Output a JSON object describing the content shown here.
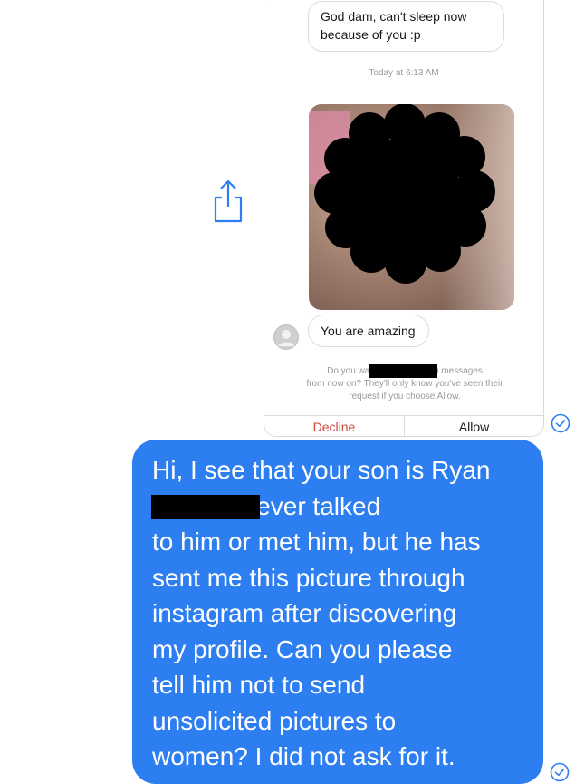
{
  "shared_screenshot": {
    "incoming_message": {
      "lines": [
        "God dam, can't sleep now",
        "because of you :p"
      ]
    },
    "timestamp": "Today at 6:13 AM",
    "photo": {
      "redacted": true
    },
    "reply_message": "You are amazing",
    "request_text": {
      "lines": [
        "Do you want to let                          send you messages",
        "from now on? They'll only know you've seen their",
        "request if you choose Allow."
      ]
    },
    "decline_label": "Decline",
    "allow_label": "Allow"
  },
  "outgoing_message": {
    "lines": [
      "Hi, I see that your son is Ryan",
      "                    . I have never talked",
      "to him or met him, but he has",
      "sent me this picture through",
      "instagram after discovering",
      "my profile. Can you please",
      "tell him not to send",
      "unsolicited pictures to",
      "women? I did not ask for it."
    ]
  },
  "colors": {
    "bubble_blue": "#2d7ef1",
    "decline_red": "#d0443a",
    "icon_blue": "#2d7ef1"
  },
  "icons": [
    "share-icon",
    "read-receipt-check-icon",
    "avatar-placeholder-icon"
  ]
}
